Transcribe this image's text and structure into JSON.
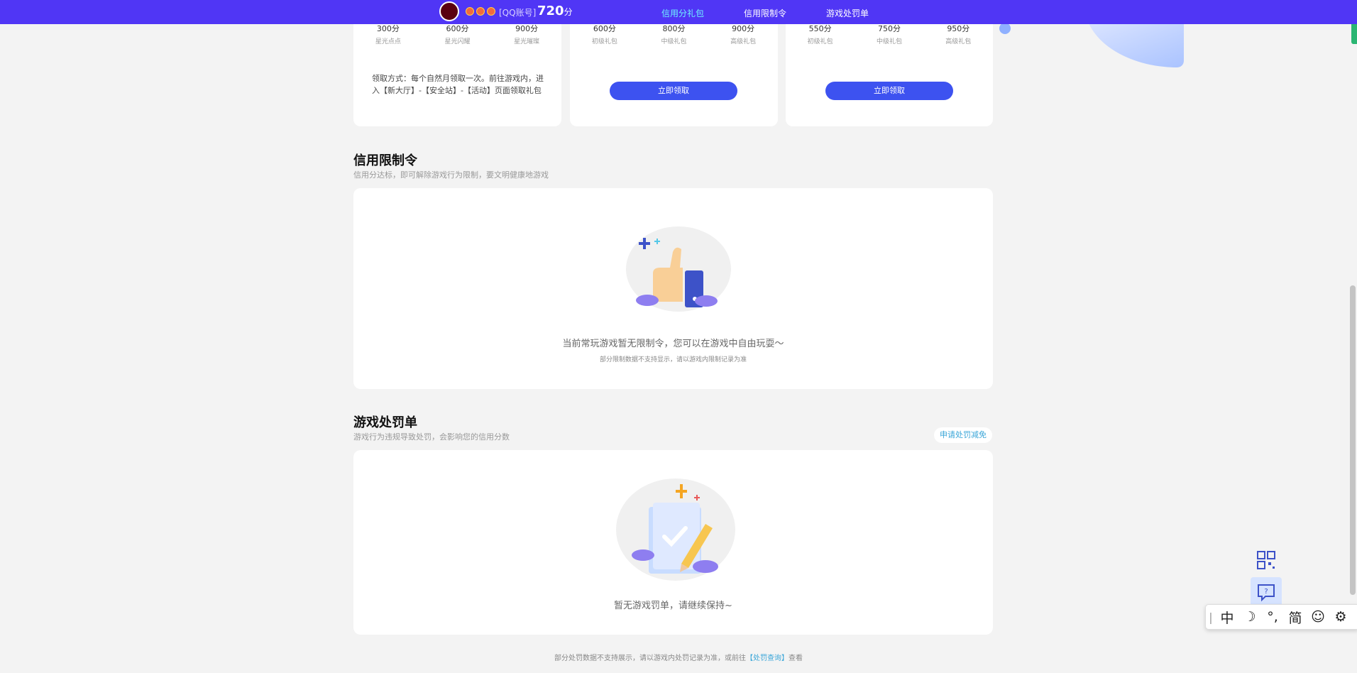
{
  "header": {
    "account_label": "[QQ账号]",
    "score_value": "720",
    "score_unit": "分",
    "nav": [
      "信用分礼包",
      "信用限制令",
      "游戏处罚单"
    ]
  },
  "gift_cards": [
    {
      "tiers": [
        {
          "points": "300分",
          "name": "星光点点"
        },
        {
          "points": "600分",
          "name": "星光闪耀"
        },
        {
          "points": "900分",
          "name": "星光璀璨"
        }
      ],
      "claim_text": "领取方式：每个自然月领取一次。前往游戏内，进入【新大厅】-【安全站】-【活动】页面领取礼包"
    },
    {
      "tiers": [
        {
          "points": "600分",
          "name": "初级礼包"
        },
        {
          "points": "800分",
          "name": "中级礼包"
        },
        {
          "points": "900分",
          "name": "高级礼包"
        }
      ],
      "button": "立即领取"
    },
    {
      "tiers": [
        {
          "points": "550分",
          "name": "初级礼包"
        },
        {
          "points": "750分",
          "name": "中级礼包"
        },
        {
          "points": "950分",
          "name": "高级礼包"
        }
      ],
      "button": "立即领取"
    }
  ],
  "restriction": {
    "title": "信用限制令",
    "subtitle": "信用分达标，即可解除游戏行为限制，要文明健康地游戏",
    "empty_main": "当前常玩游戏暂无限制令，您可以在游戏中自由玩耍～",
    "empty_sub": "部分限制数据不支持显示，请以游戏内限制记录为准"
  },
  "penalty": {
    "title": "游戏处罚单",
    "subtitle": "游戏行为违规导致处罚，会影响您的信用分数",
    "appeal_button": "申请处罚减免",
    "empty_main": "暂无游戏罚单，请继续保持~"
  },
  "footer": {
    "text_before": "部分处罚数据不支持展示，请以游戏内处罚记录为准，或前往",
    "link": "【处罚查询】",
    "text_after": "查看"
  },
  "ime_toolbar": [
    "中",
    "简"
  ],
  "colors": {
    "topbar": "#5036f5",
    "accent_blue": "#3d52f0",
    "link": "#3aa6d8",
    "nav_active": "#6ff3ff"
  }
}
